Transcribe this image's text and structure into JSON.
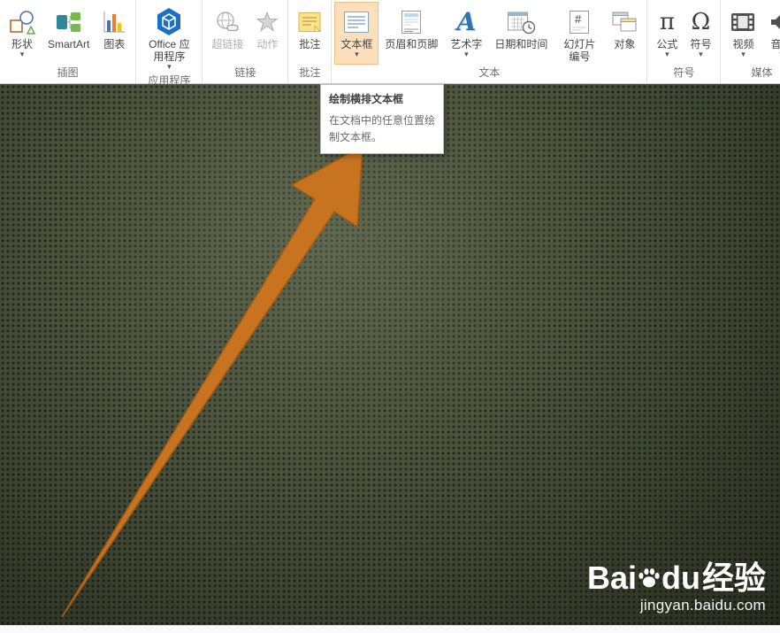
{
  "ribbon": {
    "groups": [
      {
        "label": "插图",
        "buttons": [
          {
            "label": "形状"
          },
          {
            "label": "SmartArt"
          },
          {
            "label": "图表"
          }
        ]
      },
      {
        "label": "应用程序",
        "buttons": [
          {
            "label": "Office 应用程序"
          }
        ]
      },
      {
        "label": "链接",
        "buttons": [
          {
            "label": "超链接"
          },
          {
            "label": "动作"
          }
        ]
      },
      {
        "label": "批注",
        "buttons": [
          {
            "label": "批注"
          }
        ]
      },
      {
        "label": "文本",
        "buttons": [
          {
            "label": "文本框"
          },
          {
            "label": "页眉和页脚"
          },
          {
            "label": "艺术字"
          },
          {
            "label": "日期和时间"
          },
          {
            "label": "幻灯片编号"
          },
          {
            "label": "对象"
          }
        ]
      },
      {
        "label": "符号",
        "buttons": [
          {
            "label": "公式"
          },
          {
            "label": "符号"
          }
        ]
      },
      {
        "label": "媒体",
        "buttons": [
          {
            "label": "视频"
          },
          {
            "label": "音频"
          }
        ]
      }
    ]
  },
  "tooltip": {
    "title": "绘制横排文本框",
    "body": "在文档中的任意位置绘制文本框。"
  },
  "watermark": {
    "part1": "Bai",
    "part2": "du",
    "part3": "经验",
    "url": "jingyan.baidu.com"
  },
  "icons": {
    "dropdown_arrow": "▾",
    "wordart_glyph": "A",
    "equation_glyph": "π",
    "symbol_glyph": "Ω",
    "slide_number_glyph": "#"
  },
  "colors": {
    "arrow": "#c8731f",
    "arrow_stroke": "#a85c12",
    "highlight_bg": "#fce0bd",
    "slide_bg": "#49513d"
  }
}
